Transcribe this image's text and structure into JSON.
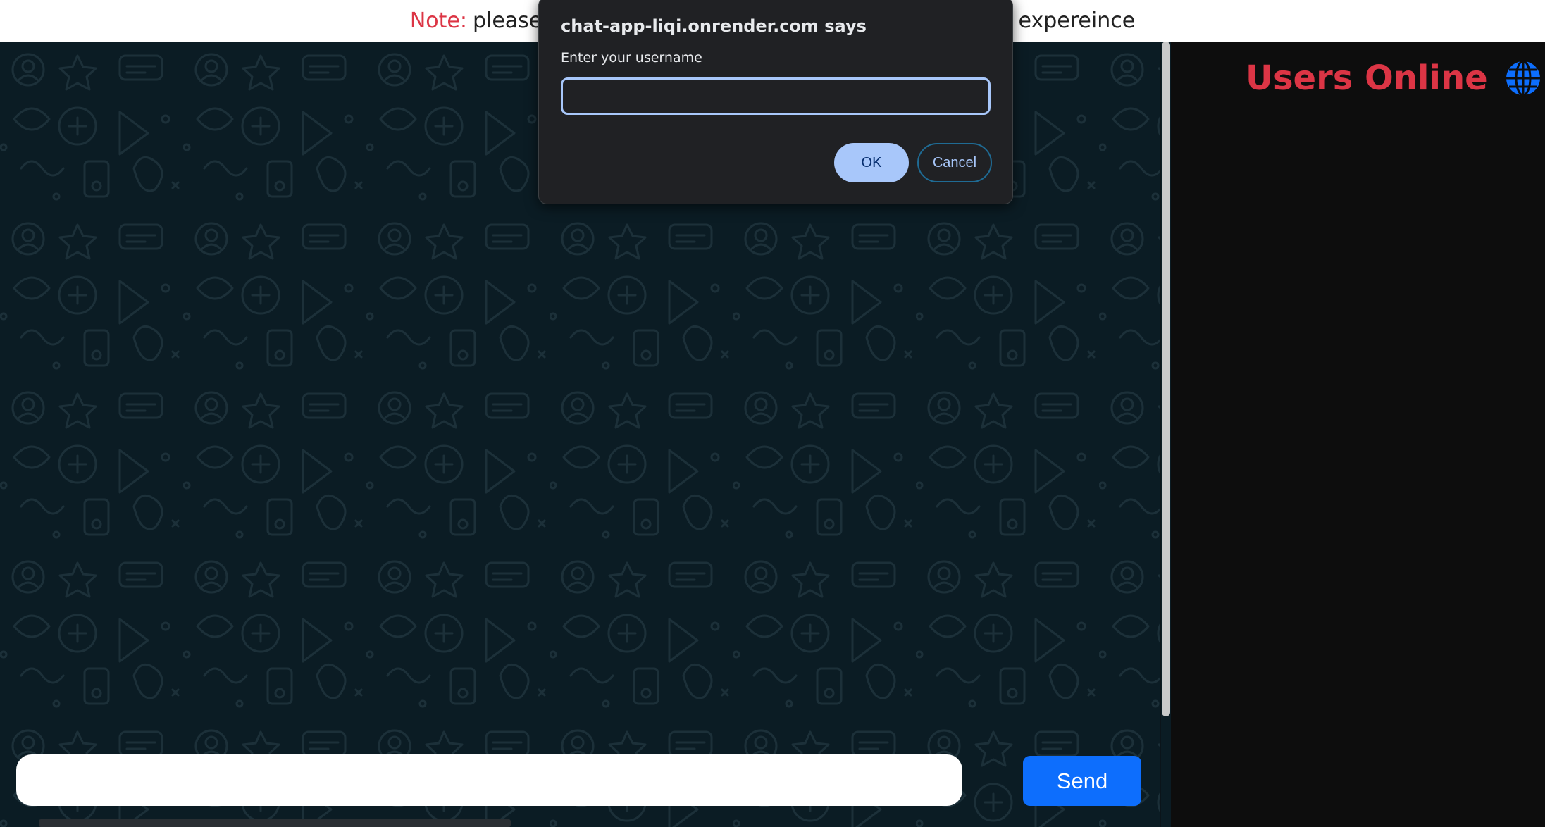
{
  "note_bar": {
    "label": "Note:",
    "text": "please",
    "text_tail": "t expereince"
  },
  "sidebar": {
    "title": "Users Online",
    "icon": "globe-icon"
  },
  "composer": {
    "input_value": "",
    "send_label": "Send"
  },
  "dialog": {
    "title": "chat-app-liqi.onrender.com says",
    "prompt": "Enter your username",
    "input_value": "",
    "ok_label": "OK",
    "cancel_label": "Cancel"
  },
  "colors": {
    "accent_red": "#dc3545",
    "send_blue": "#0d6efd",
    "chat_bg": "#0b1c24",
    "sidebar_bg": "#0d0d0d",
    "dialog_bg": "#202124",
    "dialog_accent": "#a8c7fa"
  }
}
